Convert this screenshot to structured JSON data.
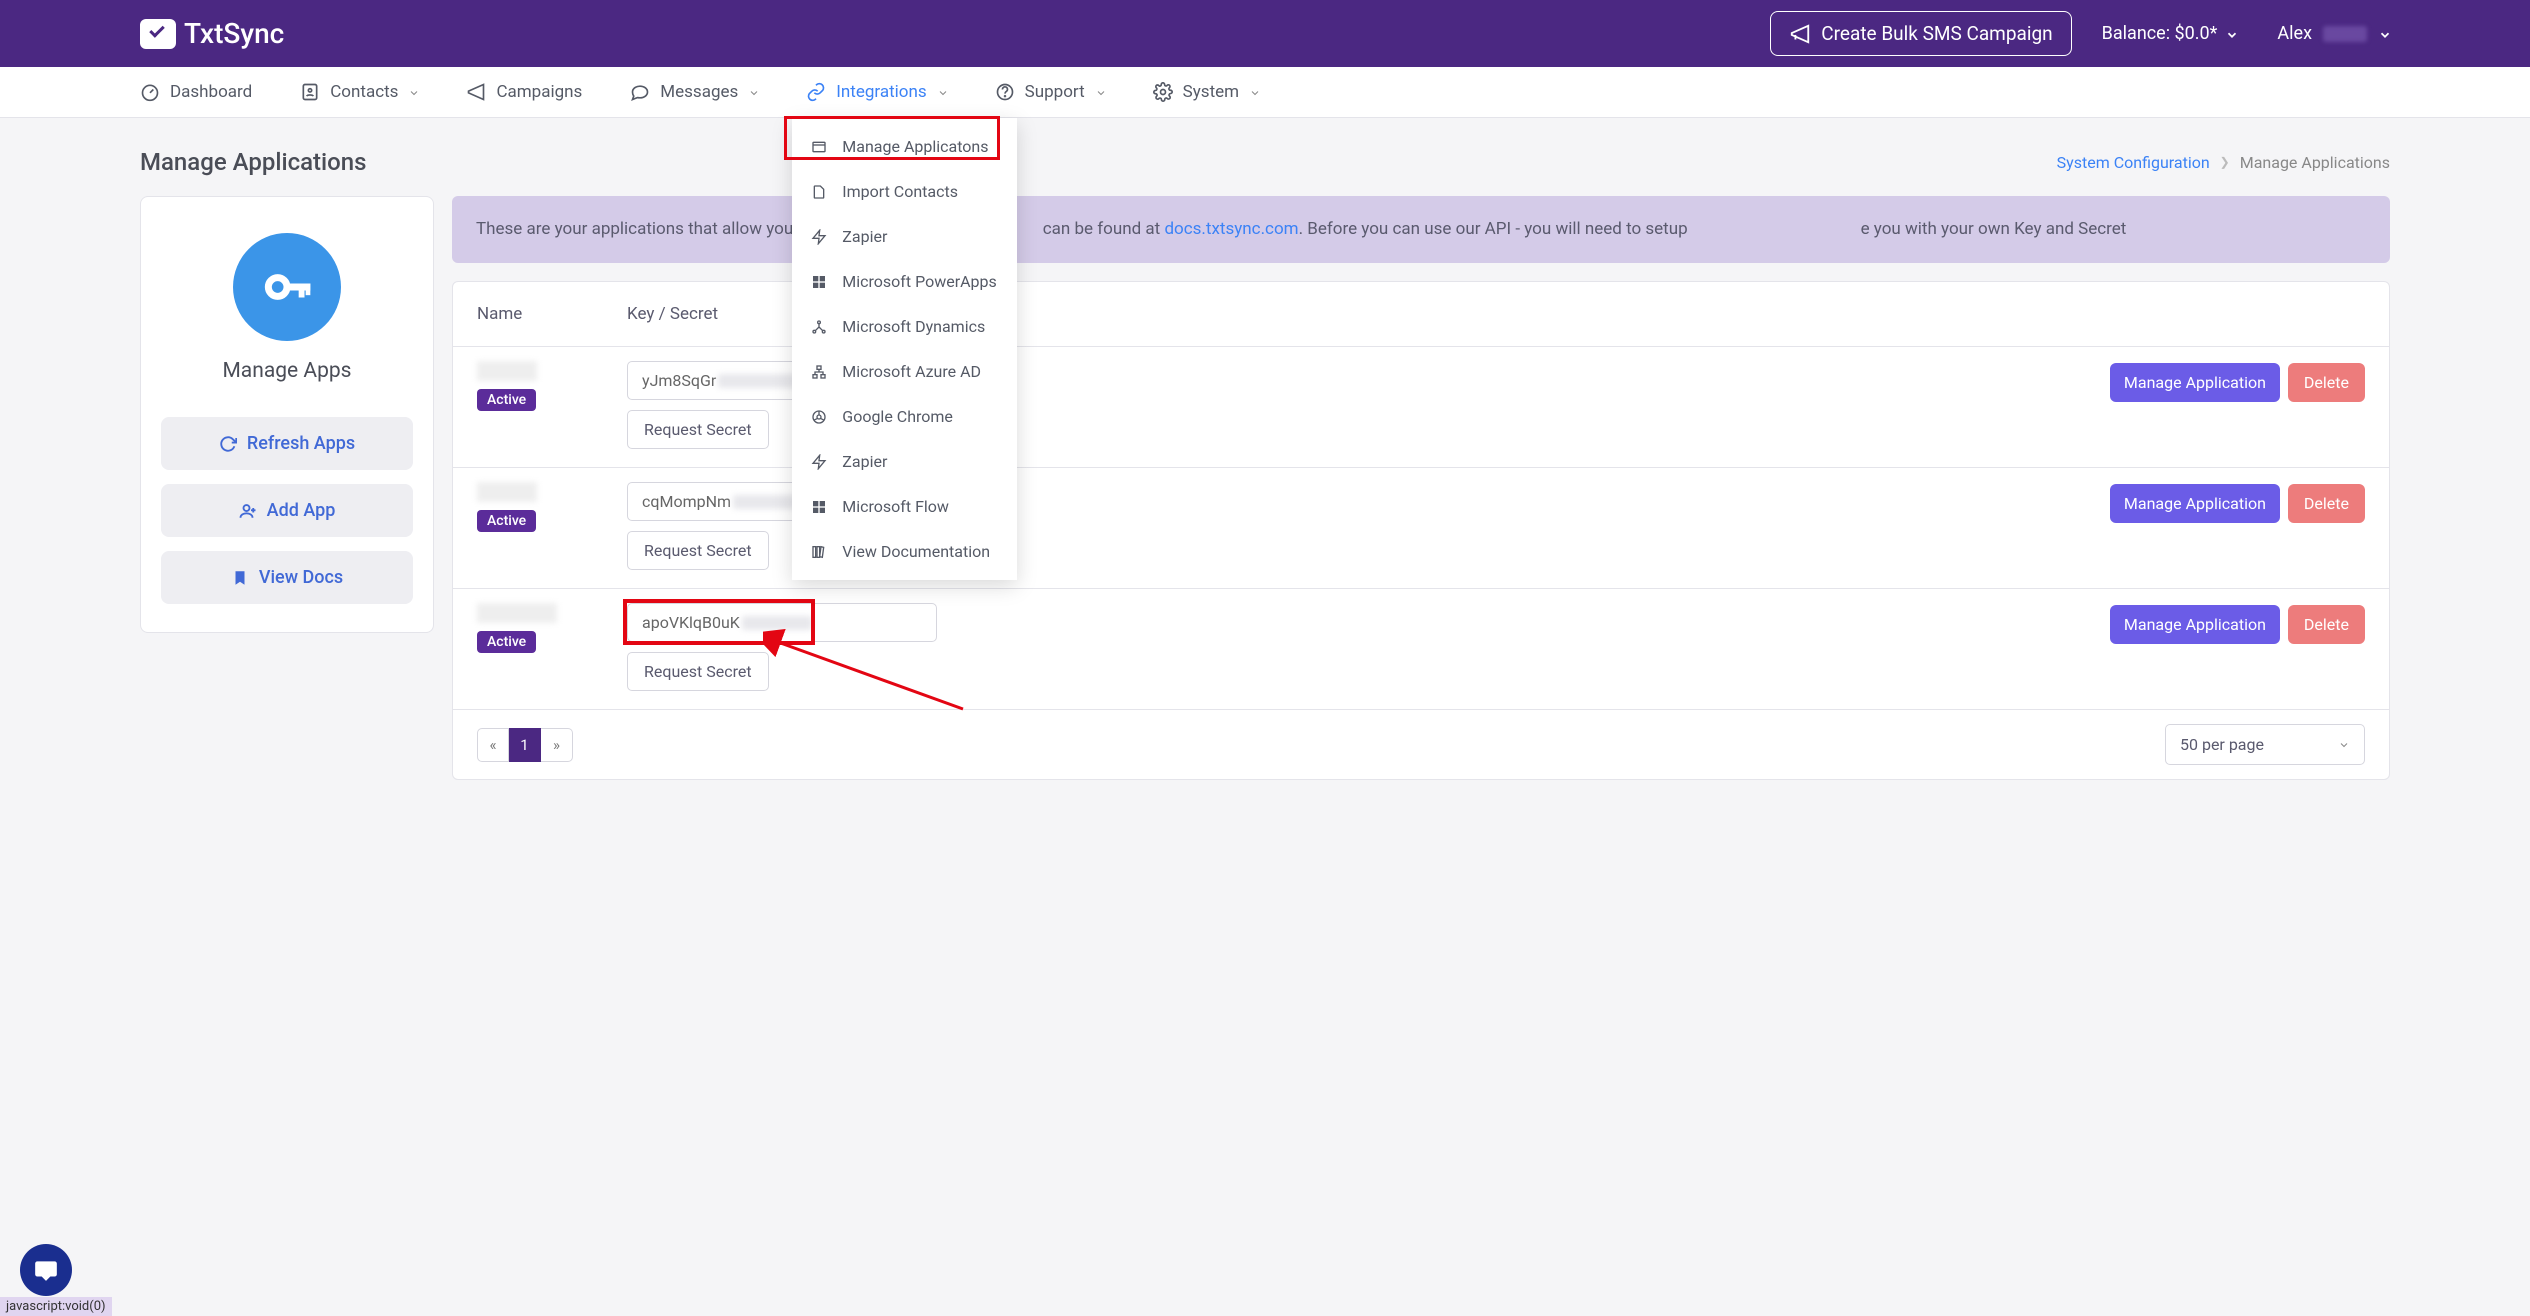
{
  "brand": {
    "name": "TxtSync"
  },
  "header": {
    "bulk_campaign": "Create Bulk SMS Campaign",
    "balance_label": "Balance: $0.0*",
    "user_name": "Alex"
  },
  "nav": {
    "dashboard": "Dashboard",
    "contacts": "Contacts",
    "campaigns": "Campaigns",
    "messages": "Messages",
    "integrations": "Integrations",
    "support": "Support",
    "system": "System"
  },
  "integrations_menu": {
    "manage_applications": "Manage Applicatons",
    "import_contacts": "Import Contacts",
    "zapier": "Zapier",
    "ms_powerapps": "Microsoft PowerApps",
    "ms_dynamics": "Microsoft Dynamics",
    "ms_azure_ad": "Microsoft Azure AD",
    "google_chrome": "Google Chrome",
    "zapier2": "Zapier",
    "ms_flow": "Microsoft Flow",
    "view_docs": "View Documentation"
  },
  "page": {
    "title": "Manage Applications",
    "breadcrumb_sysconfig": "System Configuration",
    "breadcrumb_current": "Manage Applications"
  },
  "sidebar": {
    "title": "Manage Apps",
    "refresh": "Refresh Apps",
    "add": "Add App",
    "docs": "View Docs"
  },
  "banner": {
    "pre": "These are your applications that allow you to utilize",
    "mid": "can be found at ",
    "link": "docs.txtsync.com",
    "post": ". Before you can use our API - you will need to setup",
    "end": "e you with your own Key and Secret"
  },
  "table": {
    "col_name": "Name",
    "col_key": "Key / Secret",
    "active_badge": "Active",
    "request_secret": "Request Secret",
    "manage_btn": "Manage Application",
    "delete_btn": "Delete",
    "rows": [
      {
        "key_prefix": "yJm8SqGr"
      },
      {
        "key_prefix": "cqMompNm"
      },
      {
        "key_prefix": "apoVKlqB0uK"
      }
    ]
  },
  "pagination": {
    "current": "1",
    "prev": "«",
    "next": "»",
    "per_page": "50 per page"
  },
  "status_bar": "javascript:void(0)"
}
